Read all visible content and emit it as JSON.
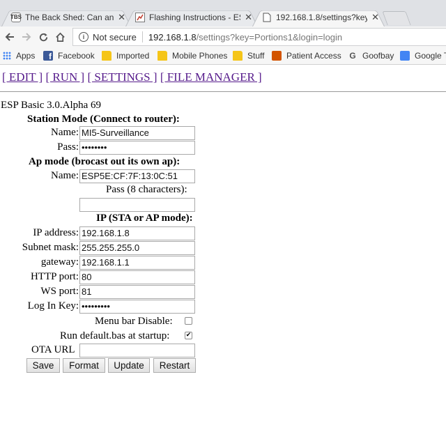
{
  "browser": {
    "tabs": [
      {
        "title": "The Back Shed: Can anyc",
        "icon": "tbs-favicon"
      },
      {
        "title": "Flashing Instructions - ES",
        "icon": "document-favicon"
      },
      {
        "title": "192.168.1.8/settings?key",
        "icon": "page-favicon"
      }
    ],
    "address": {
      "security_label": "Not secure",
      "host": "192.168.1.8",
      "path": "/settings?key=Portions1&login=login"
    },
    "bookmarks": [
      {
        "label": "Apps",
        "icon": "apps-icon"
      },
      {
        "label": "Facebook",
        "icon": "facebook-icon"
      },
      {
        "label": "Imported",
        "icon": "folder-icon"
      },
      {
        "label": "Mobile Phones",
        "icon": "folder-icon"
      },
      {
        "label": "Stuff",
        "icon": "folder-icon"
      },
      {
        "label": "Patient Access",
        "icon": "patient-access-icon"
      },
      {
        "label": "Goofbay",
        "icon": "goofbay-icon"
      },
      {
        "label": "Google T",
        "icon": "google-translate-icon"
      }
    ]
  },
  "page": {
    "menu": {
      "edit": "[ EDIT ]",
      "run": "[ RUN ]",
      "settings": "[ SETTINGS ]",
      "file_manager": "[ FILE MANAGER ]"
    },
    "version": "ESP Basic 3.0.Alpha 69",
    "station": {
      "heading": "Station Mode (Connect to router):",
      "name_label": "Name:",
      "name_value": "MI5-Surveillance",
      "pass_label": "Pass:",
      "pass_value": "••••••••"
    },
    "ap": {
      "heading": "Ap mode (brocast out its own ap):",
      "name_label": "Name:",
      "name_value": "ESP5E:CF:7F:13:0C:51",
      "pass_label": "Pass (8 characters):",
      "pass_value": ""
    },
    "ip": {
      "heading": "IP (STA or AP mode):",
      "ip_label": "IP address:",
      "ip_value": "192.168.1.8",
      "subnet_label": "Subnet mask:",
      "subnet_value": "255.255.255.0",
      "gateway_label": "gateway:",
      "gateway_value": "192.168.1.1",
      "http_label": "HTTP port:",
      "http_value": "80",
      "ws_label": "WS port:",
      "ws_value": "81",
      "login_label": "Log In Key:",
      "login_value": "•••••••••"
    },
    "options": {
      "menubar_label": "Menu bar Disable:",
      "menubar_checked": false,
      "autorun_label": "Run default.bas at startup:",
      "autorun_checked": true,
      "ota_label": "OTA URL",
      "ota_value": ""
    },
    "buttons": {
      "save": "Save",
      "format": "Format",
      "update": "Update",
      "restart": "Restart"
    }
  }
}
